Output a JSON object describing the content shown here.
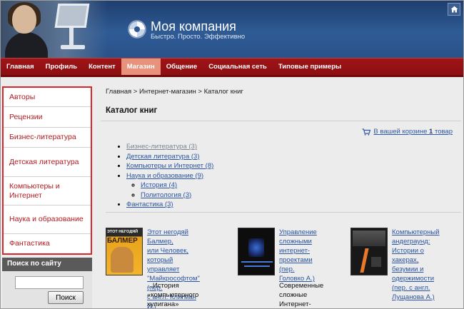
{
  "header": {
    "company_name": "Моя компания",
    "slogan": "Быстро. Просто. Эффективно"
  },
  "nav": {
    "items": [
      {
        "label": "Главная"
      },
      {
        "label": "Профиль"
      },
      {
        "label": "Контент"
      },
      {
        "label": "Магазин",
        "active": true
      },
      {
        "label": "Общение"
      },
      {
        "label": "Социальная сеть"
      },
      {
        "label": "Типовые примеры"
      }
    ]
  },
  "sidebar": {
    "items": [
      {
        "label": "Авторы"
      },
      {
        "label": "Рецензии"
      },
      {
        "label": "Бизнес-литература"
      },
      {
        "label": "Детская литература"
      },
      {
        "label": "Компьютеры и Интернет"
      },
      {
        "label": "Наука и образование"
      },
      {
        "label": "Фантастика"
      }
    ]
  },
  "search": {
    "title": "Поиск по сайту",
    "value": "",
    "button_label": "Поиск"
  },
  "main": {
    "breadcrumb": "Главная > Интернет-магазин > Каталог книг",
    "title": "Каталог книг",
    "cart": {
      "prefix": "В вашей корзине",
      "count": "1",
      "suffix": "товар",
      "icon": "cart-icon"
    },
    "categories": [
      {
        "label": "Бизнес-литература (3)",
        "visited": true
      },
      {
        "label": "Детская литература (3)"
      },
      {
        "label": "Компьютеры и Интернет (8)"
      },
      {
        "label": "Наука и образование (9)",
        "children": [
          {
            "label": "История (4)"
          },
          {
            "label": "Политология (3)"
          }
        ]
      },
      {
        "label": "Фантастика (3)"
      }
    ],
    "books": [
      {
        "title_line1": "Этот негодяй Балмер,",
        "title_line2": "или Человек, который",
        "title_line3": "управляет",
        "title_line4": "\"Майкрософтом\" (пер.",
        "title_line5": "с англ. Клигман И.)",
        "desc_line1": "...История",
        "desc_line2": "«компьютерного",
        "desc_line3": "хулигана» Стива",
        "cover_text1": "ЭТОТ НЕГОДЯЙ",
        "cover_text2": "БАЛМЕР"
      },
      {
        "title_line1": "Управление",
        "title_line2": "сложными",
        "title_line3": "интернет-",
        "title_line4": "проектами (пер.",
        "title_line5": "Головко А.)",
        "desc_line1": "Современные",
        "desc_line2": "сложные",
        "desc_line3": "Интернет-"
      },
      {
        "title_line1": "Компьютерный",
        "title_line2": "андеграунд:",
        "title_line3": "Истории о",
        "title_line4": "хакерах,",
        "title_line5": "безумии и",
        "title_line6": "одержимости",
        "title_line7": "(пер. с англ.",
        "title_line8": "Лущанова А.)"
      }
    ]
  },
  "colors": {
    "accent_red": "#a01417",
    "active_tab": "#e8927c",
    "header_blue": "#2f5b95",
    "link_blue": "#2b55a0",
    "sidebar_text": "#b01a1f"
  }
}
